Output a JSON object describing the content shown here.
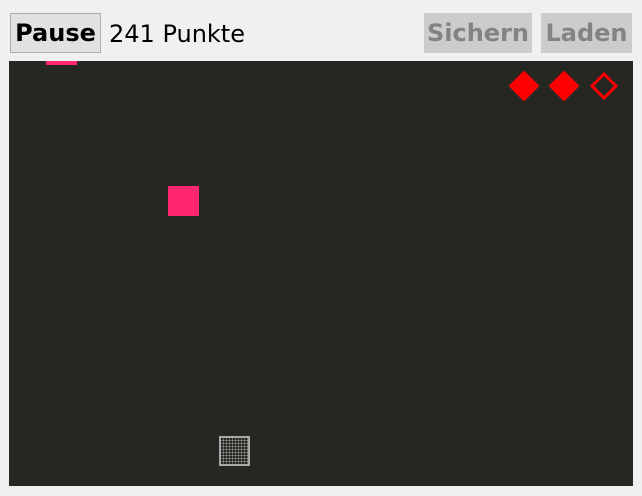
{
  "toolbar": {
    "pause_label": "Pause",
    "score_text": "241 Punkte",
    "save_label": "Sichern",
    "load_label": "Laden"
  },
  "game": {
    "field_color": "#262722",
    "block_color": "#ff2870",
    "life_color": "#ff0000",
    "lives_total": 3,
    "lives_remaining": 2,
    "lives": [
      {
        "filled": true
      },
      {
        "filled": true
      },
      {
        "filled": false
      }
    ]
  }
}
